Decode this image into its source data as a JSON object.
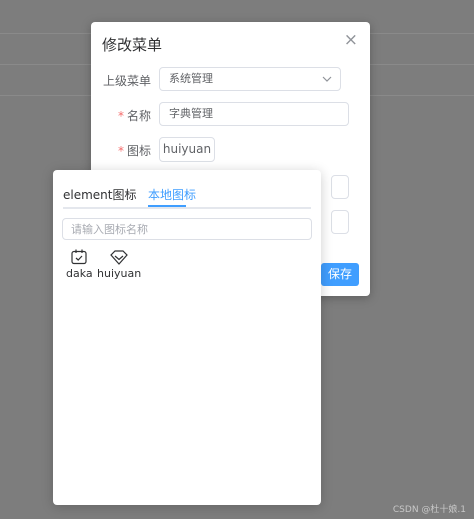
{
  "dialog": {
    "title": "修改菜单",
    "close_glyph": "×",
    "parent_label": "上级菜单",
    "parent_value": "系统管理",
    "name_required": "*",
    "name_label": "名称",
    "name_value": "字典管理",
    "icon_required": "*",
    "icon_label": "图标",
    "icon_value": "huiyuan",
    "save_label": "保存"
  },
  "popover": {
    "tabs": [
      {
        "label": "element图标",
        "active": false
      },
      {
        "label": "本地图标",
        "active": true
      }
    ],
    "search_placeholder": "请输入图标名称",
    "icons": [
      {
        "name": "daka",
        "icon": "calendar-check-icon"
      },
      {
        "name": "huiyuan",
        "icon": "diamond-icon"
      }
    ]
  },
  "watermark": "CSDN @杜十娘.1",
  "colors": {
    "accent": "#409eff",
    "required": "#f56c6c",
    "overlay": "#7d7d7d"
  }
}
